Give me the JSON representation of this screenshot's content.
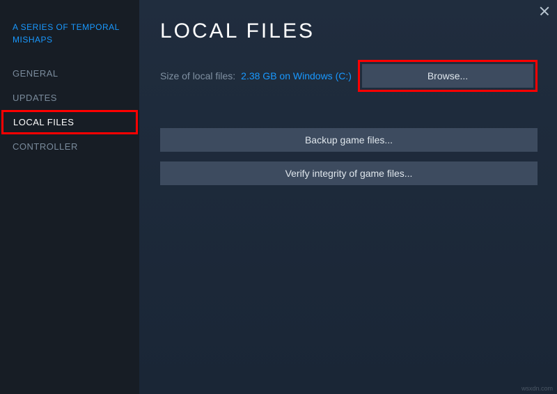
{
  "game_title": "A SERIES OF TEMPORAL MISHAPS",
  "nav": {
    "general": "GENERAL",
    "updates": "UPDATES",
    "local_files": "LOCAL FILES",
    "controller": "CONTROLLER"
  },
  "page": {
    "title": "LOCAL FILES",
    "size_label": "Size of local files:",
    "size_value": "2.38 GB on Windows (C:)",
    "browse_label": "Browse...",
    "backup_label": "Backup game files...",
    "verify_label": "Verify integrity of game files..."
  },
  "watermark": "wsxdn.com"
}
